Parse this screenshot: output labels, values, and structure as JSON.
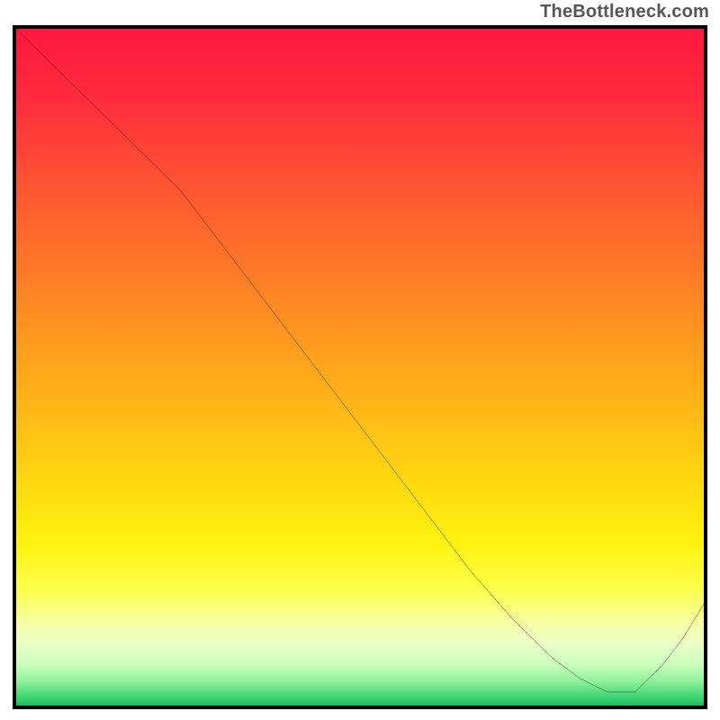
{
  "attribution": "TheBottleneck.com",
  "marker_label": "",
  "chart_data": {
    "type": "line",
    "title": "",
    "xlabel": "",
    "ylabel": "",
    "xlim": [
      0,
      100
    ],
    "ylim": [
      0,
      100
    ],
    "grid": false,
    "background": "vertical-gradient red→yellow→green (bottleneck severity heatmap)",
    "series": [
      {
        "name": "bottleneck-curve",
        "x": [
          0,
          6,
          12,
          18,
          24,
          30,
          36,
          42,
          48,
          54,
          60,
          66,
          72,
          78,
          82,
          86,
          90,
          94,
          97,
          100
        ],
        "y": [
          100,
          94,
          88,
          82,
          76,
          68,
          60,
          52,
          44,
          36,
          28,
          20,
          13,
          7,
          4,
          2,
          2,
          6,
          10,
          15
        ]
      }
    ],
    "annotations": [
      {
        "x": 84,
        "y": 1.5,
        "text": "",
        "color": "#d8382e"
      }
    ]
  }
}
